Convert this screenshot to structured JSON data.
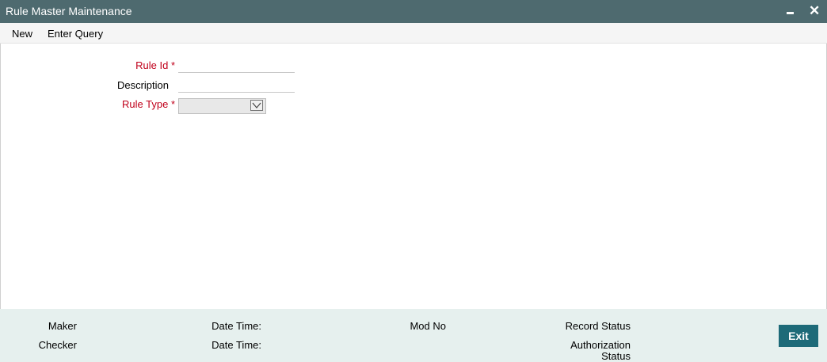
{
  "window": {
    "title": "Rule Master Maintenance"
  },
  "toolbar": {
    "new_label": "New",
    "enter_query_label": "Enter Query"
  },
  "form": {
    "rule_id": {
      "label": "Rule Id",
      "required_mark": "*",
      "value": ""
    },
    "description": {
      "label": "Description",
      "value": ""
    },
    "rule_type": {
      "label": "Rule Type",
      "required_mark": "*",
      "selected": ""
    }
  },
  "footer": {
    "maker_label": "Maker",
    "checker_label": "Checker",
    "date_time_label_1": "Date Time:",
    "date_time_label_2": "Date Time:",
    "mod_no_label": "Mod No",
    "record_status_label": "Record Status",
    "authorization_label": "Authorization",
    "status_label": "Status",
    "exit_label": "Exit"
  },
  "colors": {
    "titlebar": "#4e6a6f",
    "required_label": "#c0001b",
    "footer_bg": "#e6f0ee",
    "exit_button": "#1d6a78"
  },
  "icons": {
    "minimize": "minimize-icon",
    "close": "close-icon",
    "dropdown": "chevron-down-icon"
  }
}
